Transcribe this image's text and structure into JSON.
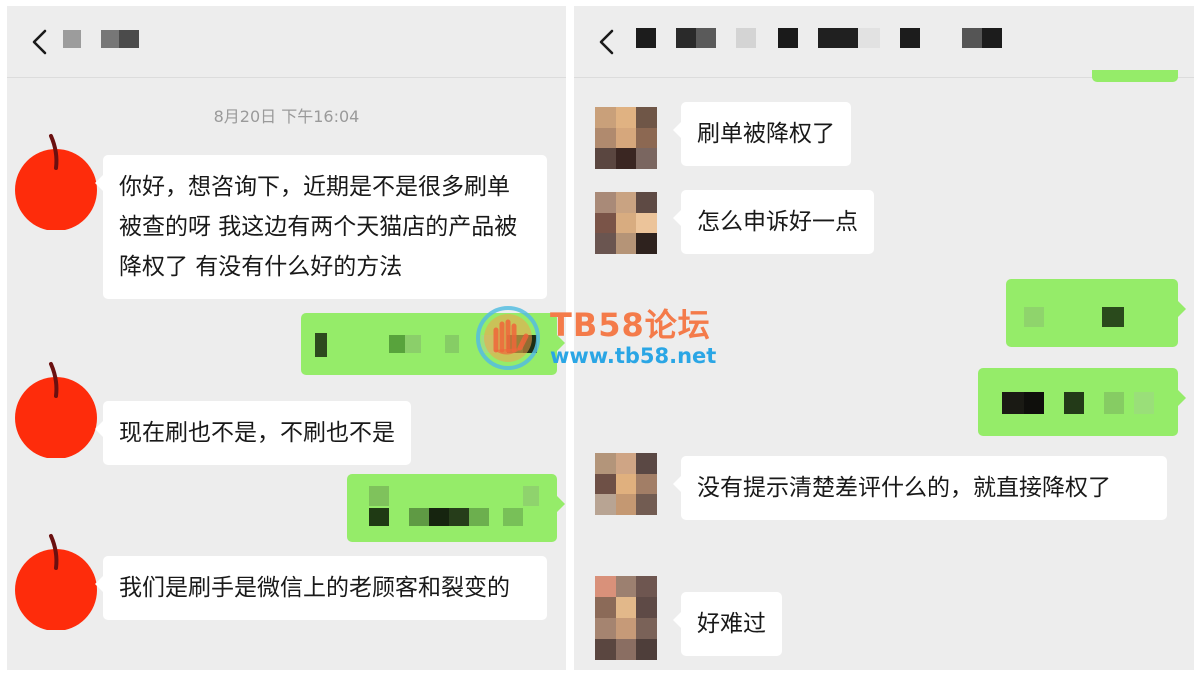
{
  "left_chat": {
    "timestamp": "8月20日 下午16:04",
    "messages": [
      {
        "side": "in",
        "text": "你好，想咨询下，近期是不是很多刷单被查的呀 我这边有两个天猫店的产品被降权了 有没有什么好的方法"
      },
      {
        "side": "out",
        "text": ""
      },
      {
        "side": "in",
        "text": "现在刷也不是，不刷也不是"
      },
      {
        "side": "out",
        "text": ""
      },
      {
        "side": "in",
        "text": "我们是刷手是微信上的老顾客和裂变的"
      }
    ]
  },
  "right_chat": {
    "messages": [
      {
        "side": "in",
        "text": "刷单被降权了"
      },
      {
        "side": "in",
        "text": "怎么申诉好一点"
      },
      {
        "side": "out",
        "text": ""
      },
      {
        "side": "out",
        "text": ""
      },
      {
        "side": "in",
        "text": "没有提示清楚差评什么的，就直接降权了"
      },
      {
        "side": "in",
        "text": "好难过"
      }
    ]
  },
  "watermark": {
    "title": "TB58论坛",
    "url": "www.tb58.net"
  },
  "icons": {
    "back": "chevron-left-icon",
    "apple_avatar": "apple-avatar-icon"
  },
  "colors": {
    "chat_background": "#ededed",
    "incoming_bubble": "#ffffff",
    "outgoing_bubble": "#95ec69",
    "timestamp_text": "#9a9a9a",
    "watermark_title": "#f47b4a",
    "watermark_url": "#2aa6e5"
  }
}
